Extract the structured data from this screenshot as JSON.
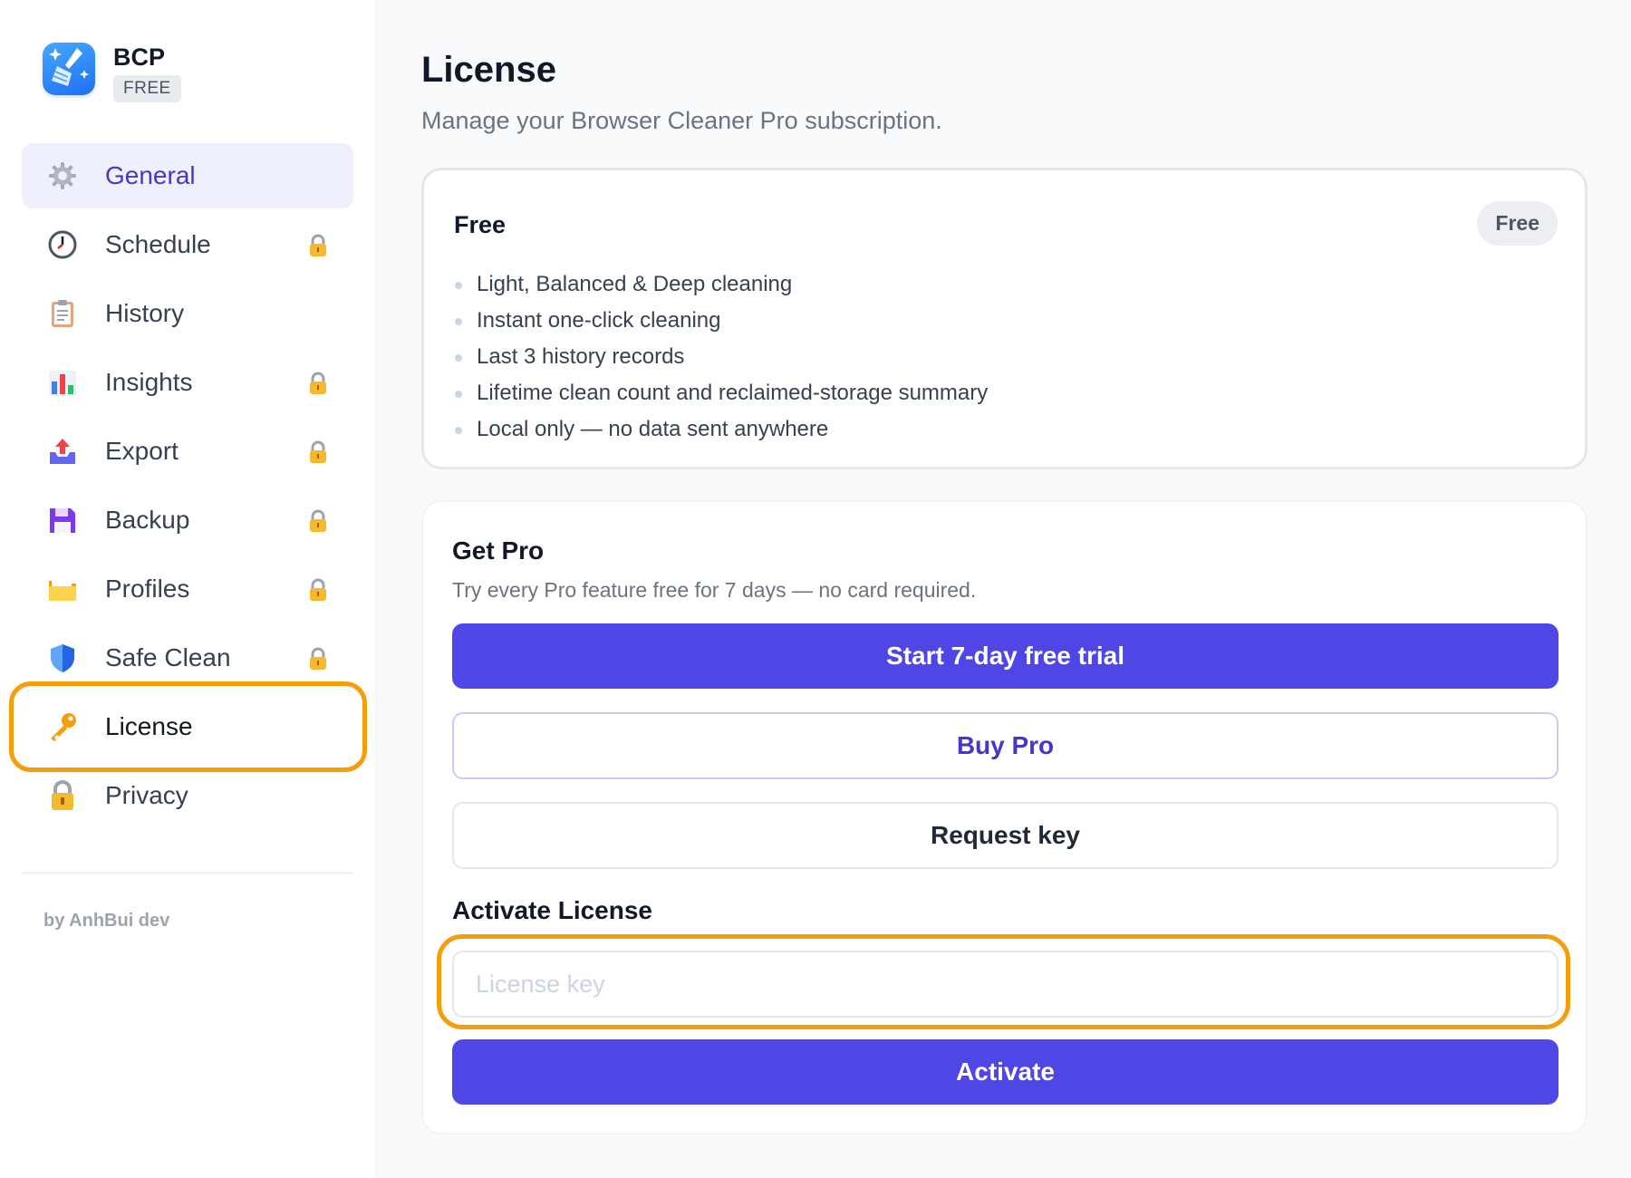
{
  "brand": {
    "name": "BCP",
    "tier": "FREE"
  },
  "sidebar": {
    "items": [
      {
        "label": "General",
        "icon": "gear-icon",
        "locked": false,
        "active": true
      },
      {
        "label": "Schedule",
        "icon": "clock-icon",
        "locked": true
      },
      {
        "label": "History",
        "icon": "clipboard-icon",
        "locked": false
      },
      {
        "label": "Insights",
        "icon": "bar-chart-icon",
        "locked": true
      },
      {
        "label": "Export",
        "icon": "export-tray-icon",
        "locked": true
      },
      {
        "label": "Backup",
        "icon": "floppy-disk-icon",
        "locked": true
      },
      {
        "label": "Profiles",
        "icon": "folder-icon",
        "locked": true
      },
      {
        "label": "Safe Clean",
        "icon": "shield-icon",
        "locked": true
      },
      {
        "label": "License",
        "icon": "key-icon",
        "locked": false,
        "highlighted": true
      },
      {
        "label": "Privacy",
        "icon": "padlock-icon",
        "locked": false
      }
    ],
    "credit": "by AnhBui dev"
  },
  "page": {
    "title": "License",
    "subtitle": "Manage your Browser Cleaner Pro subscription."
  },
  "free_plan": {
    "title": "Free",
    "badge": "Free",
    "features": [
      "Light, Balanced & Deep cleaning",
      "Instant one-click cleaning",
      "Last 3 history records",
      "Lifetime clean count and reclaimed-storage summary",
      "Local only — no data sent anywhere"
    ]
  },
  "get_pro": {
    "title": "Get Pro",
    "subtitle": "Try every Pro feature free for 7 days — no card required.",
    "trial_label": "Start 7-day free trial",
    "buy_label": "Buy Pro",
    "request_label": "Request key"
  },
  "activate": {
    "title": "Activate License",
    "input_value": "",
    "input_placeholder": "License key",
    "button_label": "Activate"
  },
  "colors": {
    "accent": "#4f46e5",
    "highlight": "#f59e0b",
    "active_nav_bg": "#eef0fd",
    "active_nav_text": "#4338ca"
  }
}
